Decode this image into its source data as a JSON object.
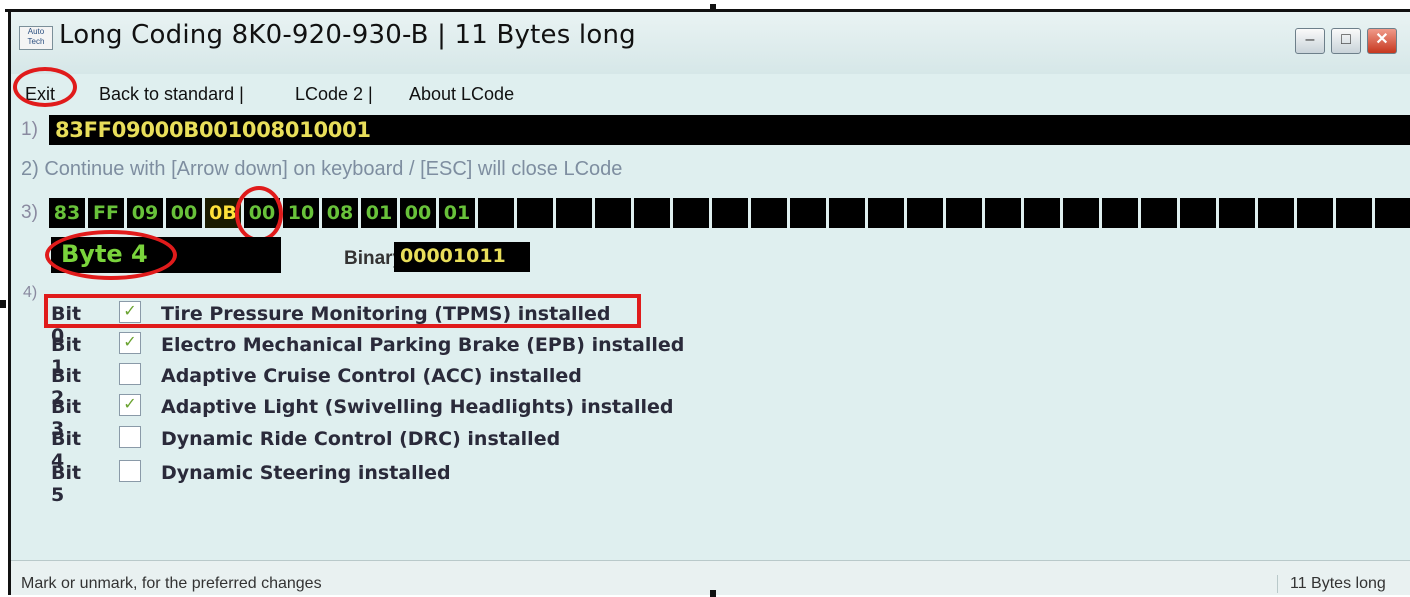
{
  "window": {
    "title": "Long Coding  8K0-920-930-B | 11 Bytes long",
    "icon_text": "Auto Tech",
    "minimize_icon": "minimize-icon",
    "maximize_icon": "maximize-icon",
    "close_icon": "close-icon"
  },
  "menu": {
    "exit": "Exit",
    "back": "Back to standard |",
    "lcode2": "LCode 2 |",
    "about": "About LCode"
  },
  "step1": {
    "label": "1)",
    "code": "83FF09000B001008010001"
  },
  "step2": {
    "text": "2) Continue with [Arrow down] on keyboard / [ESC] will close LCode"
  },
  "step3": {
    "label": "3)",
    "bytes": [
      "83",
      "FF",
      "09",
      "00",
      "0B",
      "00",
      "10",
      "08",
      "01",
      "00",
      "01",
      "",
      "",
      "",
      "",
      "",
      "",
      "",
      "",
      "",
      "",
      "",
      "",
      "",
      "",
      "",
      "",
      "",
      "",
      "",
      "",
      "",
      "",
      "",
      "",
      ""
    ],
    "selected_index": 4,
    "byte_label": "Byte 4",
    "binary_label": "Binary:",
    "binary_value": "00001011"
  },
  "step4": {
    "label": "4)",
    "bits": [
      {
        "name": "Bit 0",
        "checked": true,
        "desc": "Tire Pressure Monitoring (TPMS) installed"
      },
      {
        "name": "Bit 1",
        "checked": true,
        "desc": "Electro Mechanical Parking Brake (EPB) installed"
      },
      {
        "name": "Bit 2",
        "checked": false,
        "desc": "Adaptive Cruise Control (ACC) installed"
      },
      {
        "name": "Bit 3",
        "checked": true,
        "desc": "Adaptive Light (Swivelling Headlights) installed"
      },
      {
        "name": "Bit 4",
        "checked": false,
        "desc": "Dynamic Ride Control (DRC) installed"
      },
      {
        "name": "Bit 5",
        "checked": false,
        "desc": "Dynamic Steering installed"
      }
    ]
  },
  "status": {
    "left": "Mark or unmark, for the preferred changes",
    "right": "11 Bytes long"
  },
  "colors": {
    "annotation": "#e01b1b",
    "code_text": "#e8de5a",
    "byte_text": "#68c23a",
    "background": "#dfefef"
  }
}
